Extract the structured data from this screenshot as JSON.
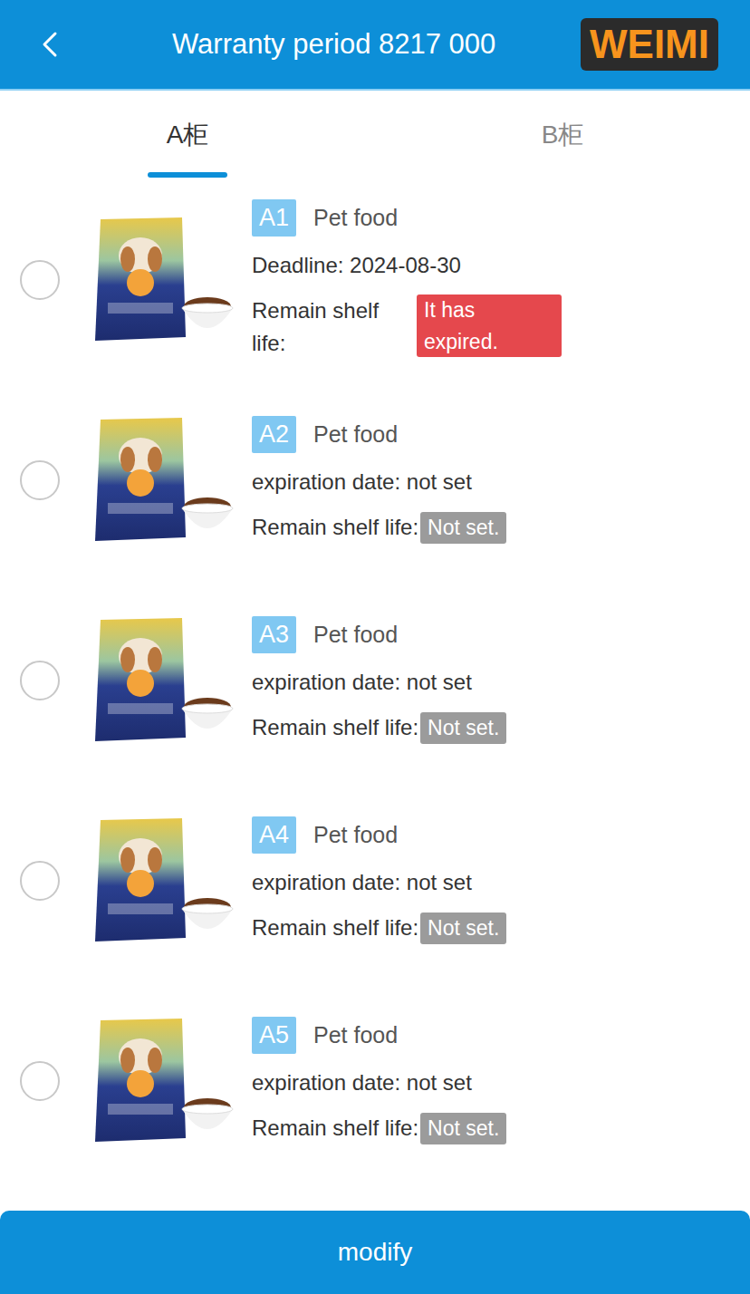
{
  "header": {
    "title": "Warranty period 8217 000",
    "logo": "WEIMI"
  },
  "tabs": [
    {
      "label": "A柜",
      "selected": true
    },
    {
      "label": "B柜",
      "selected": false
    }
  ],
  "items": [
    {
      "code": "A1",
      "name": "Pet food",
      "kind": "expired",
      "date": "Deadline: 2024-08-30",
      "shelf_label": "Remain shelf life:",
      "shelf": "It has expired.",
      "color": "#e5484d",
      "selected": false
    },
    {
      "code": "A2",
      "name": "Pet food",
      "kind": "unset",
      "date": "expiration date: not set",
      "shelf_label": "Remain shelf life:",
      "shelf": "Not set.",
      "color": "#9b9b9b",
      "selected": false
    },
    {
      "code": "A3",
      "name": "Pet food",
      "kind": "unset",
      "date": "expiration date: not set",
      "shelf_label": "Remain shelf life:",
      "shelf": "Not set.",
      "color": "#9b9b9b",
      "selected": false
    },
    {
      "code": "A4",
      "name": "Pet food",
      "kind": "unset",
      "date": "expiration date: not set",
      "shelf_label": "Remain shelf life:",
      "shelf": "Not set.",
      "color": "#9b9b9b",
      "selected": false
    },
    {
      "code": "A5",
      "name": "Pet food",
      "kind": "unset",
      "date": "expiration date: not set",
      "shelf_label": "Remain shelf life:",
      "shelf": "Not set.",
      "color": "#9b9b9b",
      "selected": false
    }
  ],
  "button": "modify"
}
